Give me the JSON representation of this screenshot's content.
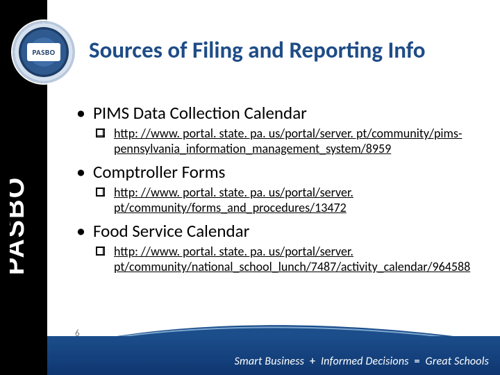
{
  "brand": {
    "acronym": "PASBO",
    "seal_label": "PASBO"
  },
  "title": "Sources of Filing and Reporting Info",
  "items": [
    {
      "heading": "PIMS Data Collection Calendar",
      "link": "http: //www. portal. state. pa. us/portal/server. pt/community/pims-pennsylvania_information_management_system/8959"
    },
    {
      "heading": "Comptroller Forms",
      "link": "http: //www. portal. state. pa. us/portal/server. pt/community/forms_and_procedures/13472"
    },
    {
      "heading": "Food Service Calendar",
      "link": "http: //www. portal. state. pa. us/portal/server. pt/community/national_school_lunch/7487/activity_calendar/964588"
    }
  ],
  "footer": {
    "page_number": "6",
    "tagline_part1": "Smart Business",
    "tagline_part2": "Informed Decisions",
    "tagline_part3": "Great Schools"
  }
}
